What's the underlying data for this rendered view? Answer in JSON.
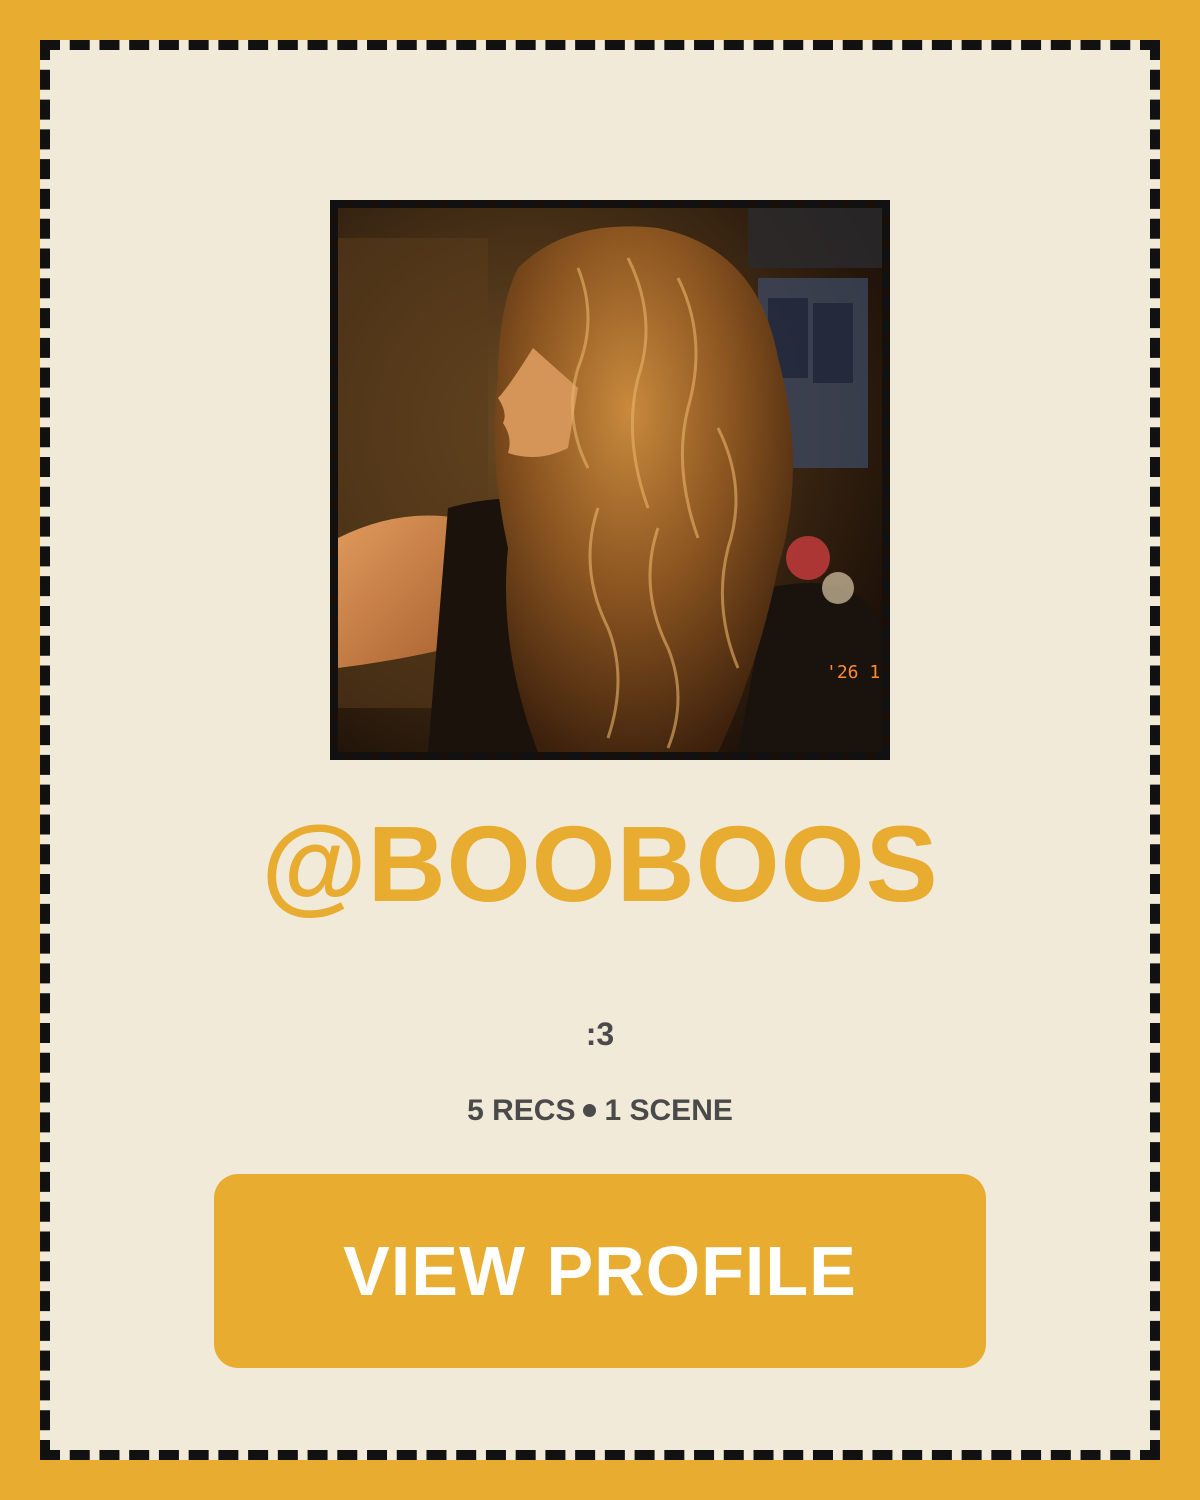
{
  "profile": {
    "username": "@BOOBOOS",
    "bio": ":3",
    "recs_label": "5 RECS",
    "scenes_label": "1 SCENE",
    "avatar_timestamp": "'26 1"
  },
  "actions": {
    "view_profile_label": "VIEW PROFILE"
  },
  "colors": {
    "accent": "#E8AC30",
    "card_background": "#F2EAD9",
    "border": "#111111",
    "text_secondary": "#4a4a4a",
    "button_text": "#ffffff"
  }
}
